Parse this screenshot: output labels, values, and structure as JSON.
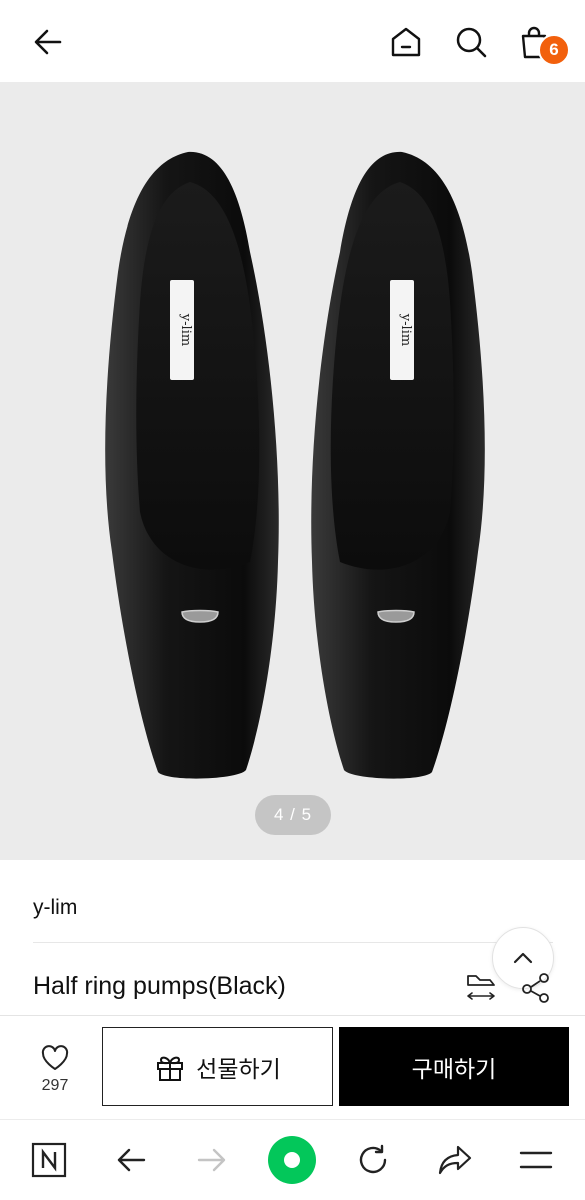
{
  "header": {
    "back_icon": "arrow-left-icon",
    "home_icon": "home-icon",
    "search_icon": "search-icon",
    "cart_icon": "shopping-bag-icon",
    "cart_count": "6",
    "badge_color": "#f2600c"
  },
  "gallery": {
    "pager": "4 / 5",
    "image_alt": "Black half ring pumps, top view",
    "insole_label": "y-lim"
  },
  "product": {
    "brand": "y-lim",
    "title": "Half ring pumps(Black)",
    "size_icon": "shoe-size-icon",
    "share_icon": "share-nodes-icon",
    "scroll_top_icon": "chevron-up-icon"
  },
  "actions": {
    "like_icon": "heart-icon",
    "like_count": "297",
    "gift_label": "선물하기",
    "gift_icon": "gift-icon",
    "buy_label": "구매하기"
  },
  "browser_nav": {
    "items": [
      "naver-n-icon",
      "back-arrow-icon",
      "forward-arrow-icon",
      "home-dot-icon",
      "refresh-icon",
      "share-arrow-icon",
      "menu-icon"
    ],
    "accent": "#03c75a"
  }
}
